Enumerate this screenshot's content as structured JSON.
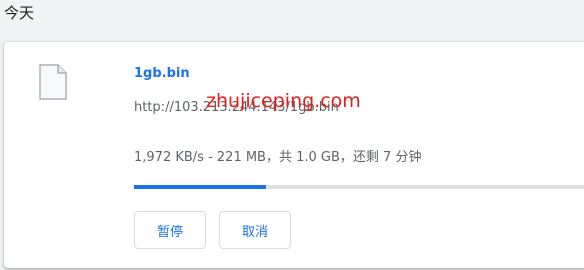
{
  "date_header": "今天",
  "download": {
    "file_name": "1gb.bin",
    "url": "http://103.213.244.143/1gb.bin",
    "status": "1,972 KB/s - 221 MB，共 1.0 GB，还剩 7 分钟",
    "progress_percent": 28,
    "pause_label": "暂停",
    "cancel_label": "取消"
  },
  "watermark_text": "zhujiceping.com",
  "colors": {
    "accent": "#1a73e8",
    "watermark": "#e0201c",
    "track": "#e0e0e0",
    "secondary_text": "#5f6368"
  },
  "icons": {
    "file": "file-icon"
  }
}
